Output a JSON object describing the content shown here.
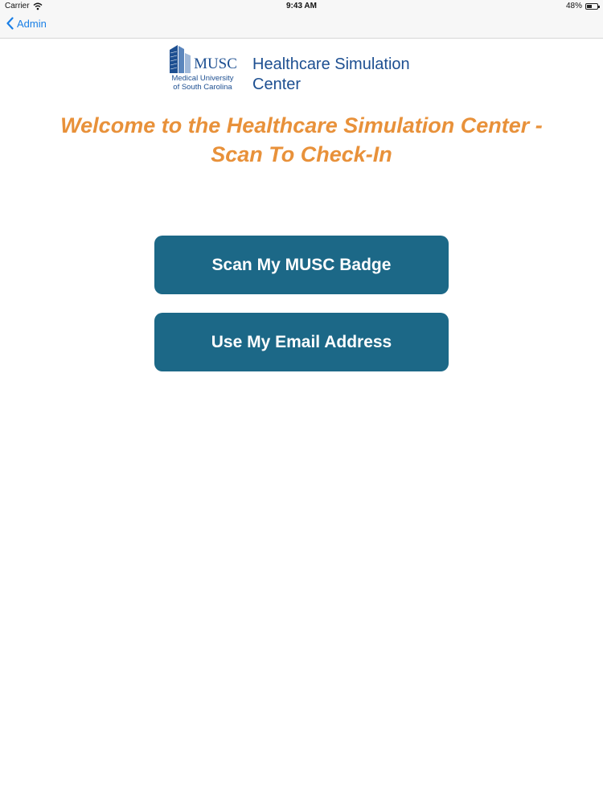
{
  "status_bar": {
    "carrier": "Carrier",
    "time": "9:43 AM",
    "battery": "48%",
    "battery_level": 0.48
  },
  "nav": {
    "back_label": "Admin"
  },
  "logo": {
    "musc": "MUSC",
    "line1": "Medical University",
    "line2": "of South Carolina"
  },
  "center": {
    "line1": "Healthcare Simulation",
    "line2": "Center"
  },
  "welcome": {
    "line1": "Welcome to the Healthcare Simulation Center -",
    "line2": "Scan To Check-In"
  },
  "buttons": {
    "scan_badge": "Scan My MUSC Badge",
    "email": "Use My Email Address"
  },
  "colors": {
    "accent_blue": "#1a7fe6",
    "brand_navy": "#1d4f91",
    "heading_orange": "#e8913a",
    "button_teal": "#1c6887"
  },
  "icons": {
    "wifi": "wifi-icon",
    "battery": "battery-icon",
    "back": "chevron-left-icon",
    "logo": "building-icon"
  }
}
